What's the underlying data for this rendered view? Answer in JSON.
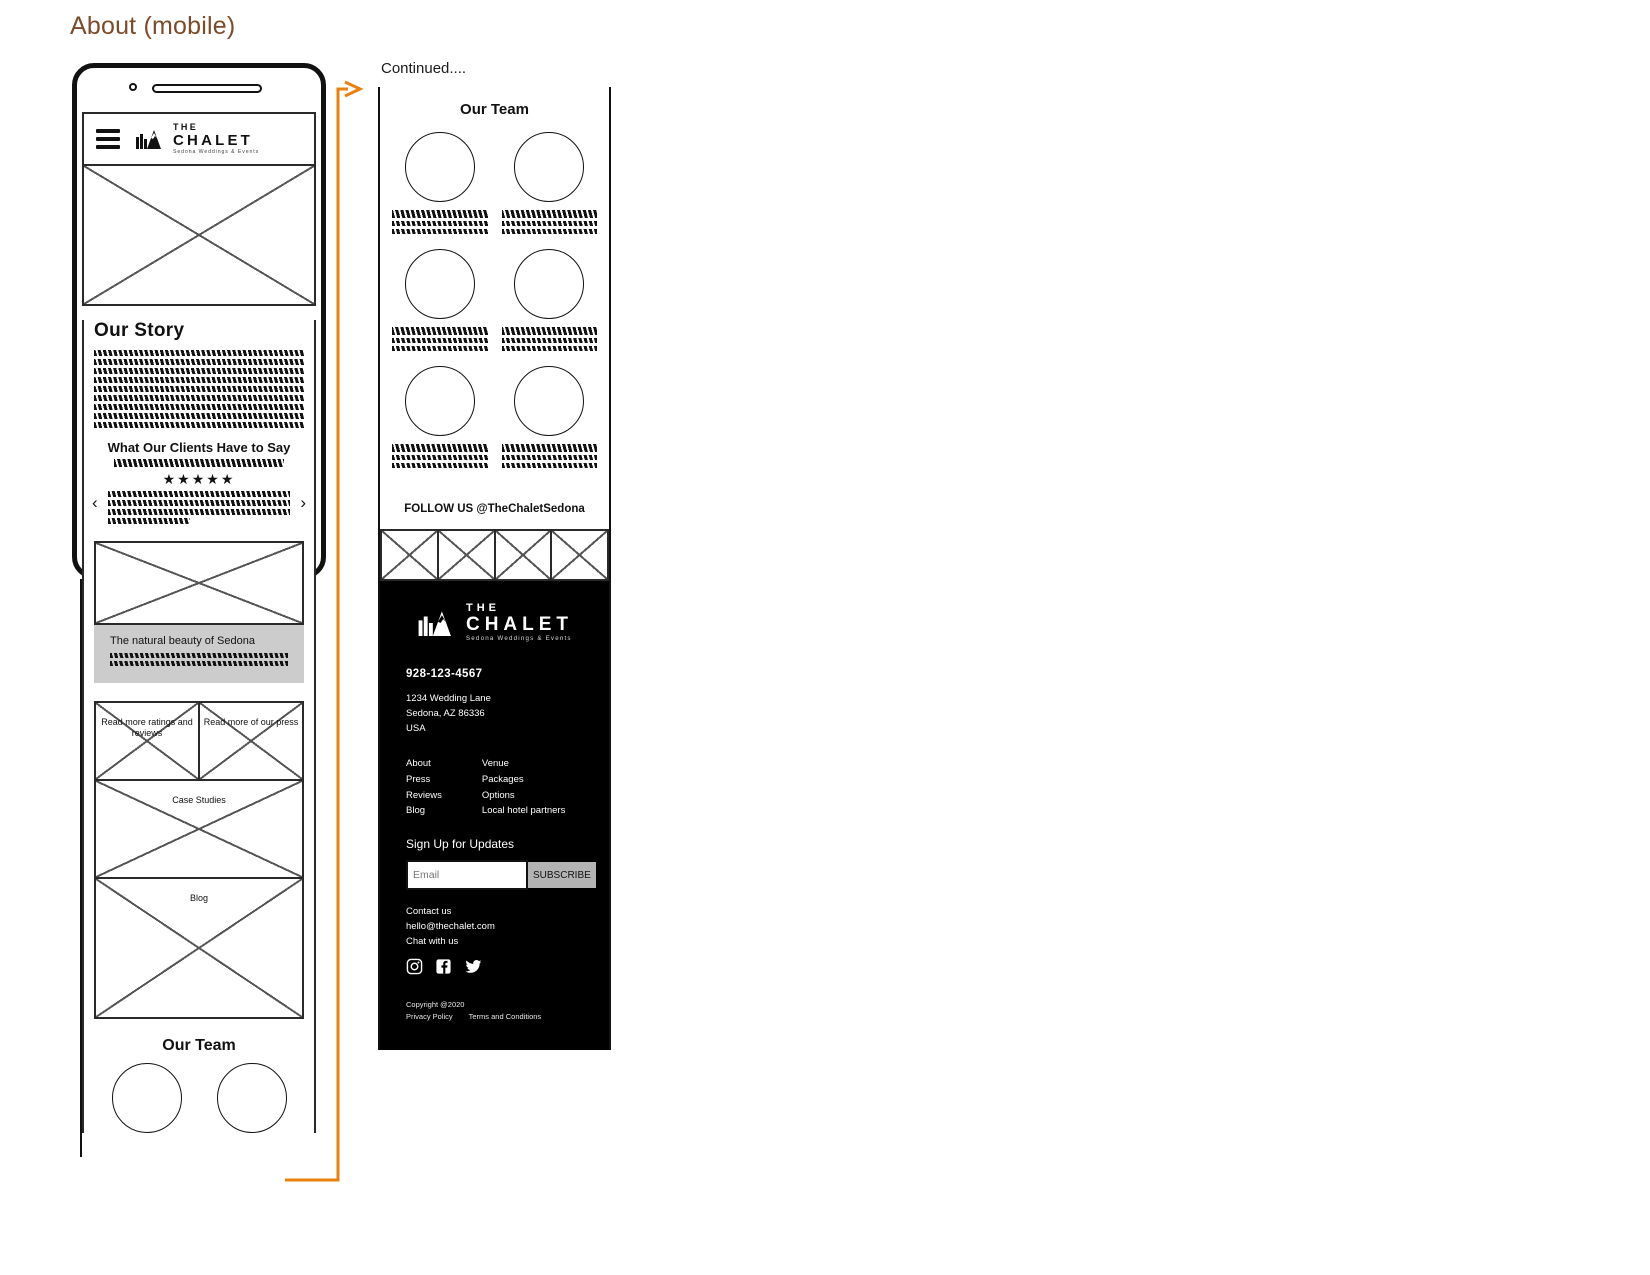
{
  "page": {
    "title": "About (mobile)",
    "continued_label": "Continued...."
  },
  "brand": {
    "the": "THE",
    "name": "CHALET",
    "tagline": "Sedona Weddings & Events",
    "logo_icon": "mountain-building-icon"
  },
  "mobile": {
    "menu_icon": "hamburger-menu-icon",
    "hero_image": "hero-image-placeholder",
    "story": {
      "heading": "Our Story",
      "body_lines": 9
    },
    "testimonials": {
      "heading": "What Our Clients Have to Say",
      "stars": "★★★★★",
      "prev_icon": "chevron-left-icon",
      "next_icon": "chevron-right-icon",
      "quote_lines": 4
    },
    "sedona": {
      "image": "sedona-image-placeholder",
      "caption": "The natural beauty of Sedona",
      "body_lines": 3
    },
    "link_tiles": [
      "Read more ratings and reviews",
      "Read more of our press",
      "Case Studies",
      "Blog"
    ],
    "team_heading": "Our Team"
  },
  "continued": {
    "team_heading": "Our Team",
    "team_members": [
      {
        "photo": "team-avatar-placeholder",
        "name_lines": 1,
        "role_lines": 2
      },
      {
        "photo": "team-avatar-placeholder",
        "name_lines": 1,
        "role_lines": 2
      },
      {
        "photo": "team-avatar-placeholder",
        "name_lines": 1,
        "role_lines": 2
      },
      {
        "photo": "team-avatar-placeholder",
        "name_lines": 1,
        "role_lines": 2
      },
      {
        "photo": "team-avatar-placeholder",
        "name_lines": 1,
        "role_lines": 2
      },
      {
        "photo": "team-avatar-placeholder",
        "name_lines": 1,
        "role_lines": 2
      }
    ],
    "follow_us": "FOLLOW US @TheChaletSedona",
    "instagram_tiles": 4
  },
  "footer": {
    "phone": "928-123-4567",
    "address": [
      "1234 Wedding Lane",
      "Sedona, AZ 86336",
      "USA"
    ],
    "links_col1": [
      "About",
      "Press",
      "Reviews",
      "Blog"
    ],
    "links_col2": [
      "Venue",
      "Packages",
      "Options",
      "Local hotel partners"
    ],
    "signup_heading": "Sign Up for Updates",
    "email_placeholder": "Email",
    "subscribe_label": "SUBSCRIBE",
    "contact": [
      "Contact us",
      "hello@thechalet.com",
      "Chat with us"
    ],
    "socials": [
      "instagram-icon",
      "facebook-icon",
      "twitter-icon"
    ],
    "copyright": "Copyright @2020",
    "privacy": "Privacy Policy",
    "terms": "Terms and Conditions"
  },
  "colors": {
    "title": "#7b4b2a",
    "connector": "#e8820c",
    "footer_bg": "#000000",
    "caption_bg": "#cccccc",
    "subscribe_bg": "#b3b3b3"
  }
}
